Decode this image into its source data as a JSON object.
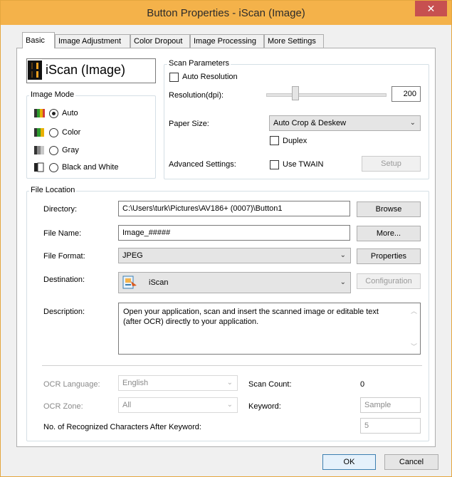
{
  "window": {
    "title": "Button Properties - iScan (Image)",
    "close_glyph": "✕"
  },
  "tabs": [
    {
      "label": "Basic",
      "active": true
    },
    {
      "label": "Image Adjustment",
      "active": false
    },
    {
      "label": "Color Dropout",
      "active": false
    },
    {
      "label": "Image Processing",
      "active": false
    },
    {
      "label": "More Settings",
      "active": false
    }
  ],
  "button_name": {
    "label": "iScan (Image)",
    "icon": "digit-display-icon"
  },
  "image_mode": {
    "group_label": "Image Mode",
    "selected": "Auto",
    "options": [
      {
        "label": "Auto",
        "icon": "auto-color-icon"
      },
      {
        "label": "Color",
        "icon": "color-mode-icon"
      },
      {
        "label": "Gray",
        "icon": "gray-mode-icon"
      },
      {
        "label": "Black and White",
        "icon": "bw-mode-icon"
      }
    ]
  },
  "scan_params": {
    "group_label": "Scan Parameters",
    "auto_resolution_label": "Auto Resolution",
    "auto_resolution_checked": false,
    "resolution_label": "Resolution(dpi):",
    "resolution_value": "200",
    "paper_size_label": "Paper Size:",
    "paper_size_value": "Auto Crop & Deskew",
    "duplex_label": "Duplex",
    "duplex_checked": false,
    "advanced_label": "Advanced Settings:",
    "use_twain_label": "Use TWAIN",
    "use_twain_checked": false,
    "setup_label": "Setup"
  },
  "file_location": {
    "group_label": "File Location",
    "directory_label": "Directory:",
    "directory_value": "C:\\Users\\turk\\Pictures\\AV186+ (0007)\\Button1",
    "browse_label": "Browse",
    "file_name_label": "File Name:",
    "file_name_value": "Image_#####",
    "more_label": "More...",
    "file_format_label": "File Format:",
    "file_format_value": "JPEG",
    "properties_label": "Properties",
    "destination_label": "Destination:",
    "destination_value": "iScan",
    "configuration_label": "Configuration",
    "description_label": "Description:",
    "description_value": "Open your application, scan and insert the scanned image or editable text (after OCR) directly to your application."
  },
  "ocr": {
    "language_label": "OCR Language:",
    "language_value": "English",
    "zone_label": "OCR Zone:",
    "zone_value": "All",
    "scan_count_label": "Scan Count:",
    "scan_count_value": "0",
    "keyword_label": "Keyword:",
    "keyword_value": "Sample",
    "recognized_label": "No. of Recognized Characters After Keyword:",
    "recognized_value": "5"
  },
  "footer": {
    "ok_label": "OK",
    "cancel_label": "Cancel"
  },
  "colors": {
    "titlebar": "#f4b24a",
    "close": "#c75050",
    "accent": "#3c7fb1"
  }
}
